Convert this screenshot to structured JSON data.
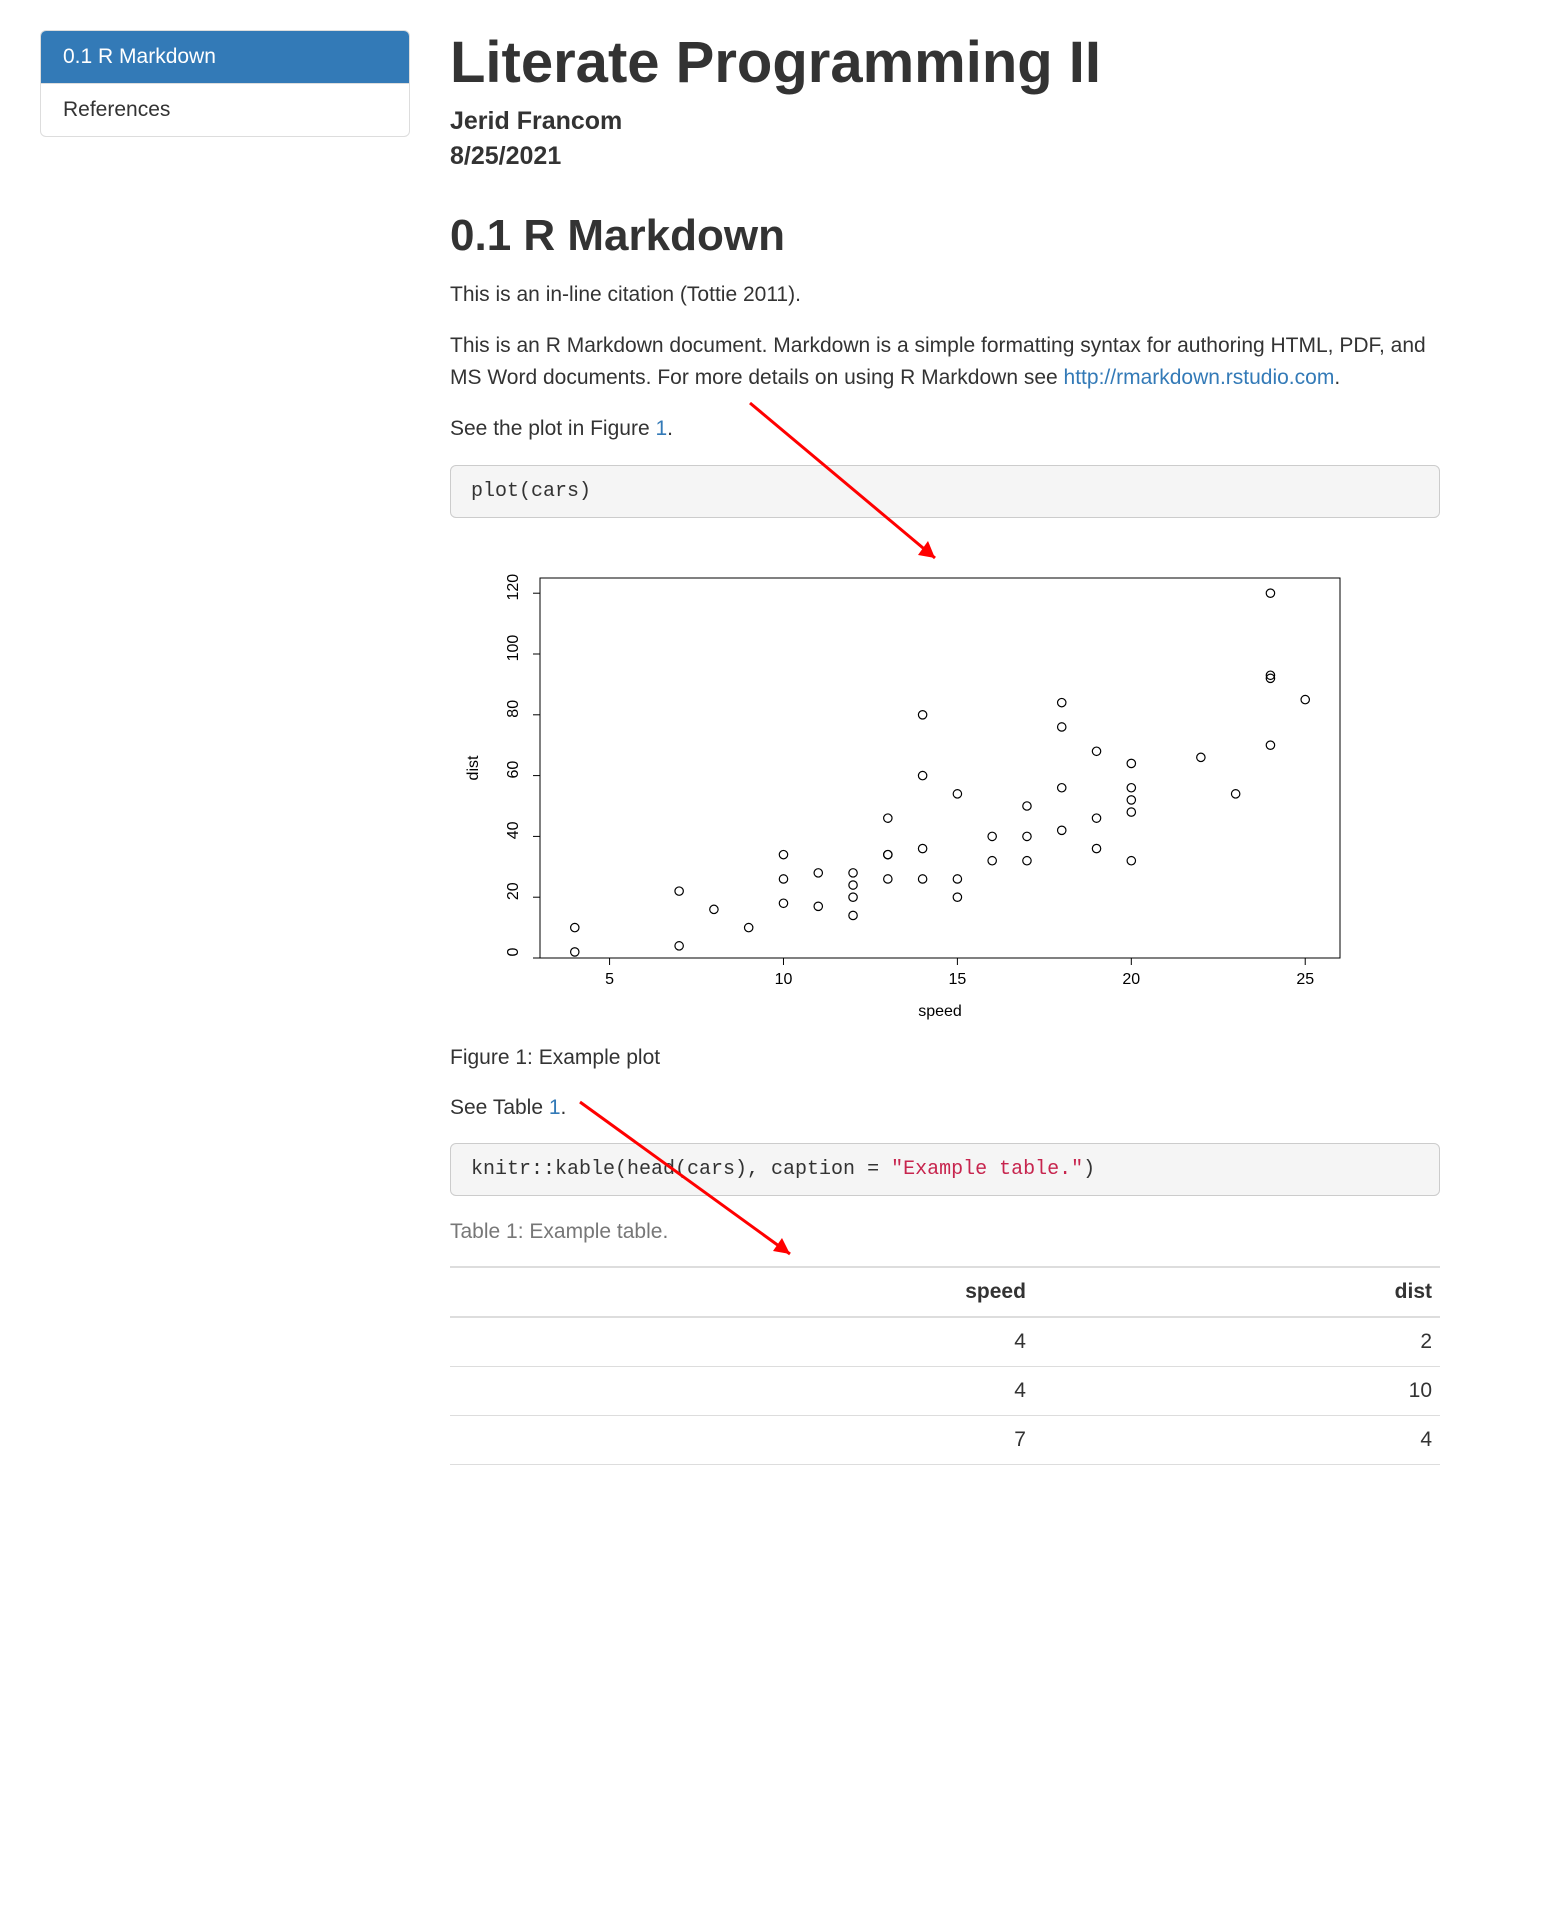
{
  "toc": {
    "items": [
      {
        "label": "0.1 R Markdown",
        "active": true
      },
      {
        "label": "References",
        "active": false
      }
    ]
  },
  "header": {
    "title": "Literate Programming II",
    "author": "Jerid Francom",
    "date": "8/25/2021"
  },
  "section": {
    "heading": "0.1 R Markdown",
    "citation_line": "This is an in-line citation (Tottie 2011).",
    "intro_pre": "This is an R Markdown document. Markdown is a simple formatting syntax for authoring HTML, PDF, and MS Word documents. For more details on using R Markdown see ",
    "intro_link_text": "http://rmarkdown.rstudio.com",
    "intro_post": ".",
    "see_plot_pre": "See the plot in Figure ",
    "see_plot_link": "1",
    "see_plot_post": ".",
    "code1": "plot(cars)",
    "fig_caption": "Figure 1: Example plot",
    "see_table_pre": "See Table ",
    "see_table_link": "1",
    "see_table_post": ".",
    "code2_pre": "knitr::kable(head(cars), caption = ",
    "code2_str": "\"Example table.\"",
    "code2_post": ")",
    "table_caption": "Table 1: Example table."
  },
  "chart_data": {
    "type": "scatter",
    "xlabel": "speed",
    "ylabel": "dist",
    "xlim": [
      3,
      26
    ],
    "ylim": [
      0,
      125
    ],
    "xticks": [
      5,
      10,
      15,
      20,
      25
    ],
    "yticks": [
      0,
      20,
      40,
      60,
      80,
      100,
      120
    ],
    "series": [
      {
        "name": "cars",
        "points": [
          [
            4,
            2
          ],
          [
            4,
            10
          ],
          [
            7,
            4
          ],
          [
            7,
            22
          ],
          [
            8,
            16
          ],
          [
            9,
            10
          ],
          [
            10,
            18
          ],
          [
            10,
            26
          ],
          [
            10,
            34
          ],
          [
            11,
            17
          ],
          [
            11,
            28
          ],
          [
            12,
            14
          ],
          [
            12,
            20
          ],
          [
            12,
            24
          ],
          [
            12,
            28
          ],
          [
            13,
            26
          ],
          [
            13,
            34
          ],
          [
            13,
            34
          ],
          [
            13,
            46
          ],
          [
            14,
            26
          ],
          [
            14,
            36
          ],
          [
            14,
            60
          ],
          [
            14,
            80
          ],
          [
            15,
            20
          ],
          [
            15,
            26
          ],
          [
            15,
            54
          ],
          [
            16,
            32
          ],
          [
            16,
            40
          ],
          [
            17,
            32
          ],
          [
            17,
            40
          ],
          [
            17,
            50
          ],
          [
            18,
            42
          ],
          [
            18,
            56
          ],
          [
            18,
            76
          ],
          [
            18,
            84
          ],
          [
            19,
            36
          ],
          [
            19,
            46
          ],
          [
            19,
            68
          ],
          [
            20,
            32
          ],
          [
            20,
            48
          ],
          [
            20,
            52
          ],
          [
            20,
            56
          ],
          [
            20,
            64
          ],
          [
            22,
            66
          ],
          [
            23,
            54
          ],
          [
            24,
            70
          ],
          [
            24,
            92
          ],
          [
            24,
            93
          ],
          [
            24,
            120
          ],
          [
            25,
            85
          ]
        ]
      }
    ]
  },
  "table": {
    "headers": [
      "speed",
      "dist"
    ],
    "rows": [
      [
        4,
        2
      ],
      [
        4,
        10
      ],
      [
        7,
        4
      ]
    ]
  },
  "colors": {
    "accent": "#337ab7",
    "arrow": "#ff0000",
    "code_str": "#c7254e"
  }
}
